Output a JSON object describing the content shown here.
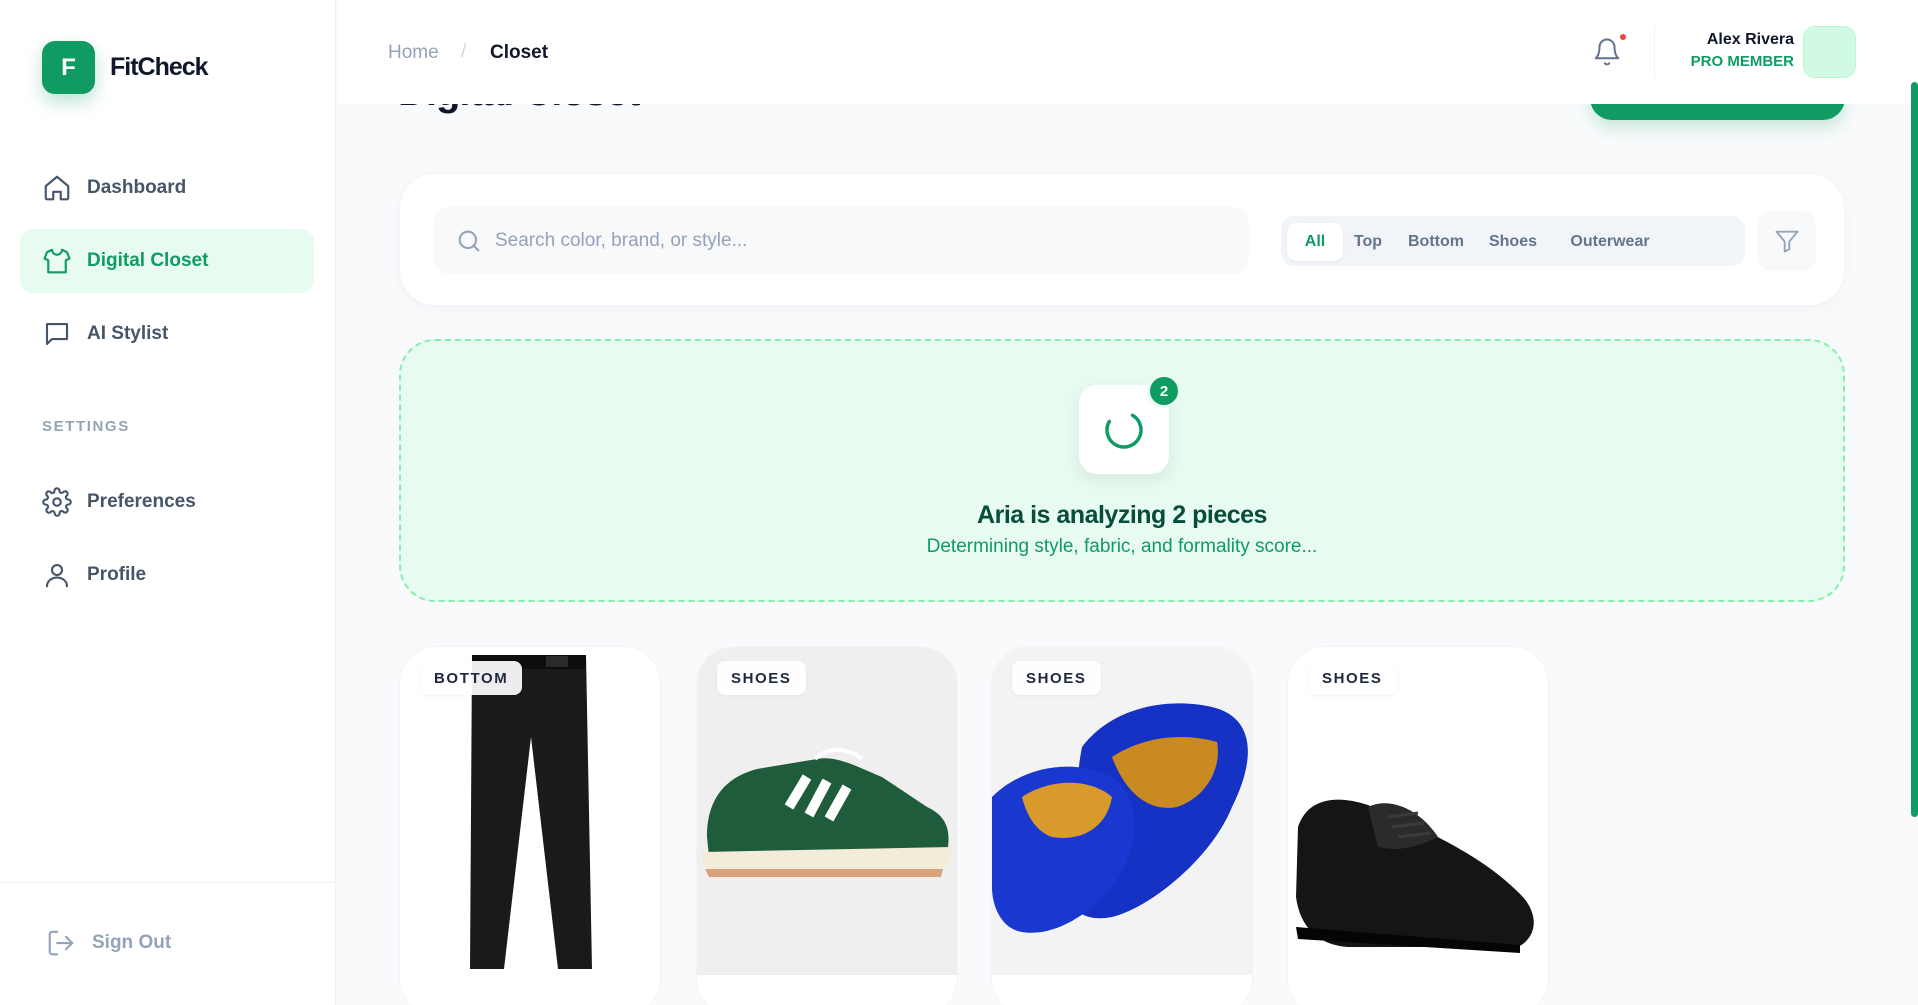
{
  "brand": {
    "logo_letter": "F",
    "name": "FitCheck",
    "accent": "#109b63"
  },
  "sidebar": {
    "items": [
      {
        "label": "Dashboard",
        "icon": "home-icon"
      },
      {
        "label": "Digital Closet",
        "icon": "shirt-icon",
        "active": true
      },
      {
        "label": "AI Stylist",
        "icon": "chat-icon"
      }
    ],
    "section_label": "SETTINGS",
    "settings_items": [
      {
        "label": "Preferences",
        "icon": "gear-icon"
      },
      {
        "label": "Profile",
        "icon": "user-icon"
      }
    ],
    "sign_out": "Sign Out"
  },
  "header": {
    "breadcrumb": {
      "home": "Home",
      "separator": "/",
      "current": "Closet"
    },
    "user": {
      "name": "Alex Rivera",
      "role": "PRO MEMBER"
    }
  },
  "page": {
    "title": "Digital Closet"
  },
  "search": {
    "placeholder": "Search color, brand, or style...",
    "filters": [
      "All",
      "Top",
      "Bottom",
      "Shoes",
      "Outerwear"
    ],
    "active_filter": "All"
  },
  "analyzing": {
    "count": "2",
    "title": "Aria is analyzing 2 pieces",
    "subtitle": "Determining style, fabric, and formality score..."
  },
  "items": [
    {
      "category": "BOTTOM",
      "image": "black-trousers"
    },
    {
      "category": "SHOES",
      "image": "green-sneaker"
    },
    {
      "category": "SHOES",
      "image": "blue-loafers"
    },
    {
      "category": "SHOES",
      "image": "black-oxford"
    }
  ]
}
